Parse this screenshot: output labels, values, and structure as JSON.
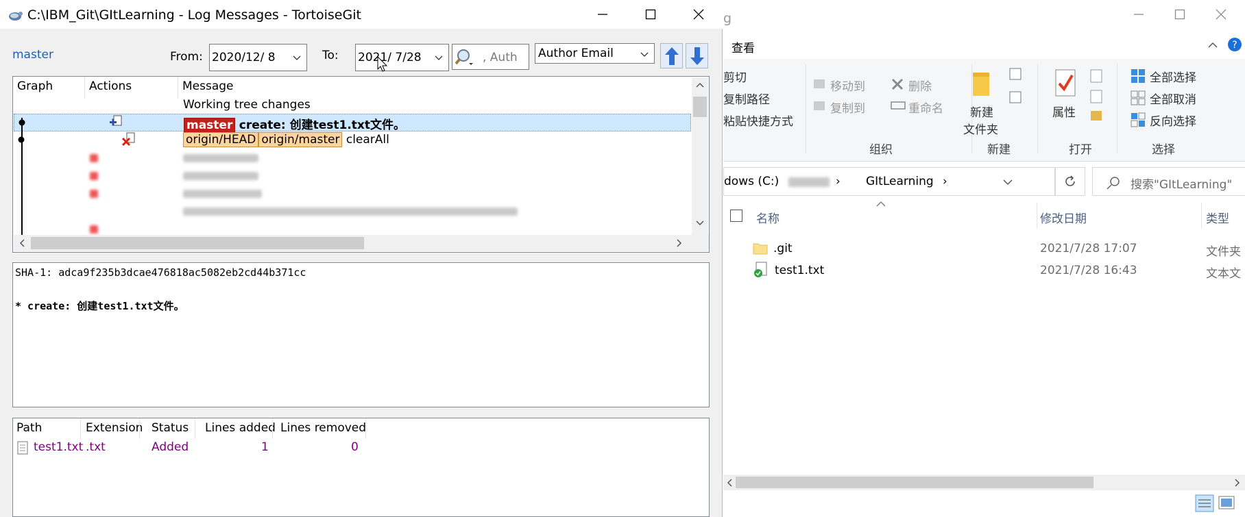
{
  "tortoisegit": {
    "title": "C:\\IBM_Git\\GItLearning - Log Messages - TortoiseGit",
    "branch": "master",
    "from_label": "From:",
    "from_date": "2020/12/  8",
    "to_label": "To:",
    "to_date": "2021/  7/28",
    "search_placeholder": ", Auth",
    "filter_field": "Author Email",
    "columns": [
      "Graph",
      "Actions",
      "Message"
    ],
    "rows": [
      {
        "message": "Working tree changes"
      },
      {
        "tags": [
          "master"
        ],
        "message": "create: 创建test1.txt文件。",
        "selected": true
      },
      {
        "tags": [
          "origin/HEAD",
          "origin/master"
        ],
        "message": "clearAll"
      },
      {
        "message": " "
      },
      {
        "message": " "
      },
      {
        "message": " "
      },
      {
        "message": " "
      },
      {
        "message": " "
      }
    ],
    "details": {
      "sha": "SHA-1: adca9f235b3dcae476818ac5082eb2cd44b371cc",
      "subject": "* create: 创建test1.txt文件。"
    },
    "files": {
      "columns": [
        "Path",
        "Extension",
        "Status",
        "Lines added",
        "Lines removed"
      ],
      "rows": [
        {
          "path": "test1.txt",
          "extension": ".txt",
          "status": "Added",
          "added": "1",
          "removed": "0"
        }
      ]
    }
  },
  "explorer": {
    "title_fragment": "g",
    "tab": "查看",
    "ribbon": {
      "cut": "剪切",
      "copy_path": "复制路径",
      "paste_shortcut": "粘贴快捷方式",
      "move_to": "移动到",
      "copy_to": "复制到",
      "delete": "删除",
      "rename": "重命名",
      "new_folder_1": "新建",
      "new_folder_2": "文件夹",
      "properties": "属性",
      "select_all": "全部选择",
      "select_none": "全部取消",
      "invert_selection": "反向选择",
      "group_organize": "组织",
      "group_new": "新建",
      "group_open": "打开",
      "group_select": "选择"
    },
    "address": {
      "drive": "dows (C:)",
      "folder": "GItLearning"
    },
    "search_placeholder": "搜索\"GItLearning\"",
    "columns": {
      "name": "名称",
      "modified": "修改日期",
      "type": "类型"
    },
    "files": [
      {
        "name": ".git",
        "modified": "2021/7/28 17:07",
        "type": "文件夹"
      },
      {
        "name": "test1.txt",
        "modified": "2021/7/28 16:43",
        "type": "文本文"
      }
    ]
  }
}
